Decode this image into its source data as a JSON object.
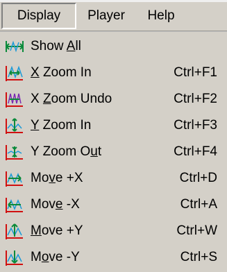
{
  "menubar": {
    "items": [
      {
        "label": "Display"
      },
      {
        "label": "Player"
      },
      {
        "label": "Help"
      }
    ]
  },
  "menu": {
    "items": [
      {
        "pre": "Show ",
        "mn": "A",
        "post": "ll",
        "shortcut": "",
        "icon": "show-all-icon",
        "color": "#0a8a3a"
      },
      {
        "pre": "",
        "mn": "X",
        "post": " Zoom In",
        "shortcut": "Ctrl+F1",
        "icon": "x-zoom-in-icon",
        "color": "#d01010"
      },
      {
        "pre": "X ",
        "mn": "Z",
        "post": "oom Undo",
        "shortcut": "Ctrl+F2",
        "icon": "x-zoom-undo-icon",
        "color": "#d01010"
      },
      {
        "pre": "",
        "mn": "Y",
        "post": " Zoom In",
        "shortcut": "Ctrl+F3",
        "icon": "y-zoom-in-icon",
        "color": "#d01010"
      },
      {
        "pre": "Y Zoom O",
        "mn": "u",
        "post": "t",
        "shortcut": "Ctrl+F4",
        "icon": "y-zoom-out-icon",
        "color": "#d01010"
      },
      {
        "pre": "Mo",
        "mn": "v",
        "post": "e +X",
        "shortcut": "Ctrl+D",
        "icon": "move-plus-x-icon",
        "color": "#d01010"
      },
      {
        "pre": "Mov",
        "mn": "e",
        "post": " -X",
        "shortcut": "Ctrl+A",
        "icon": "move-minus-x-icon",
        "color": "#d01010"
      },
      {
        "pre": "",
        "mn": "M",
        "post": "ove +Y",
        "shortcut": "Ctrl+W",
        "icon": "move-plus-y-icon",
        "color": "#d01010"
      },
      {
        "pre": "M",
        "mn": "o",
        "post": "ve -Y",
        "shortcut": "Ctrl+S",
        "icon": "move-minus-y-icon",
        "color": "#d01010"
      }
    ]
  }
}
